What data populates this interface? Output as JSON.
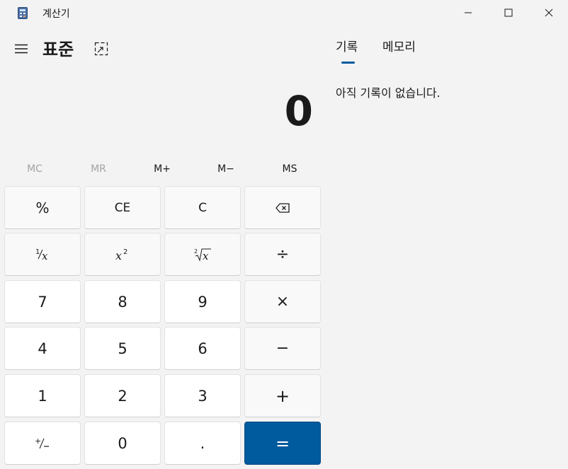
{
  "window": {
    "title": "계산기"
  },
  "header": {
    "mode_title": "표준"
  },
  "display": {
    "value": "0"
  },
  "memory": {
    "mc": "MC",
    "mr": "MR",
    "mplus": "M+",
    "mminus": "M−",
    "ms": "MS"
  },
  "keys": {
    "percent": "%",
    "ce": "CE",
    "c": "C",
    "divide": "÷",
    "seven": "7",
    "eight": "8",
    "nine": "9",
    "multiply": "×",
    "four": "4",
    "five": "5",
    "six": "6",
    "minus": "−",
    "one": "1",
    "two": "2",
    "three": "3",
    "plus": "+",
    "zero": "0",
    "decimal": ".",
    "equals": "="
  },
  "panel": {
    "tabs": [
      "기록",
      "메모리"
    ],
    "active_tab": "기록",
    "empty_message": "아직 기록이 없습니다."
  },
  "colors": {
    "accent": "#005a9e",
    "background": "#f3f3f3",
    "disabled_text": "#a3a3a3"
  }
}
